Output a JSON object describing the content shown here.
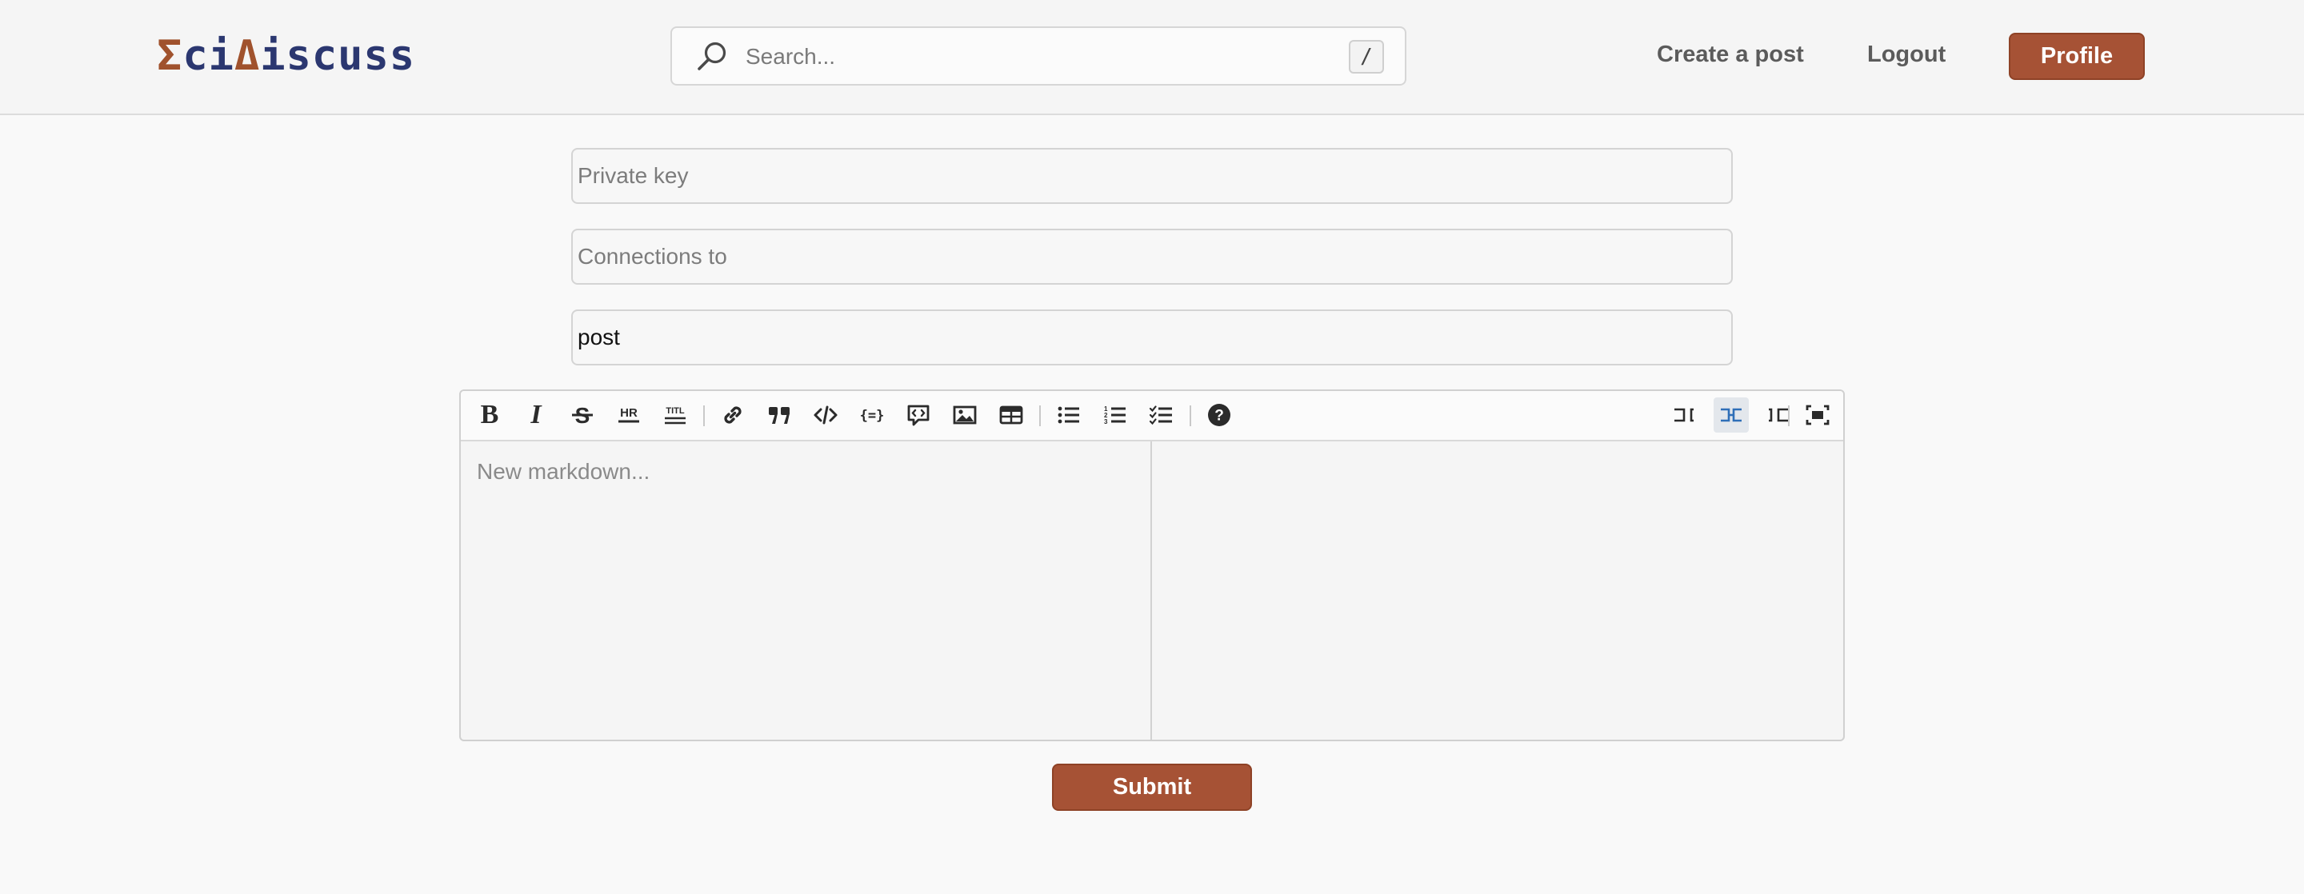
{
  "header": {
    "logo": {
      "part1": "Σ",
      "part2": "ci",
      "part3": "Δ",
      "part4": "iscuss"
    },
    "search": {
      "placeholder": "Search...",
      "shortcut": "/"
    },
    "nav": {
      "create_post": "Create a post",
      "logout": "Logout",
      "profile": "Profile"
    }
  },
  "form": {
    "private_key": {
      "value": "",
      "placeholder": "Private key"
    },
    "connections": {
      "value": "",
      "placeholder": "Connections to"
    },
    "type": {
      "value": "post",
      "placeholder": ""
    },
    "editor": {
      "placeholder": "New markdown...",
      "toolbar": [
        "bold",
        "italic",
        "strikethrough",
        "horizontal-rule",
        "title",
        "link",
        "quote",
        "code",
        "code-block",
        "comment",
        "image",
        "table",
        "unordered-list",
        "ordered-list",
        "task-list",
        "help",
        "editor-only",
        "split-view",
        "preview-only",
        "fullscreen"
      ],
      "active_view": "split-view"
    },
    "submit_label": "Submit"
  },
  "colors": {
    "accent": "#a65235",
    "logo_navy": "#2b3770",
    "logo_rust": "#a0522d",
    "active_icon": "#2f6fb8"
  }
}
